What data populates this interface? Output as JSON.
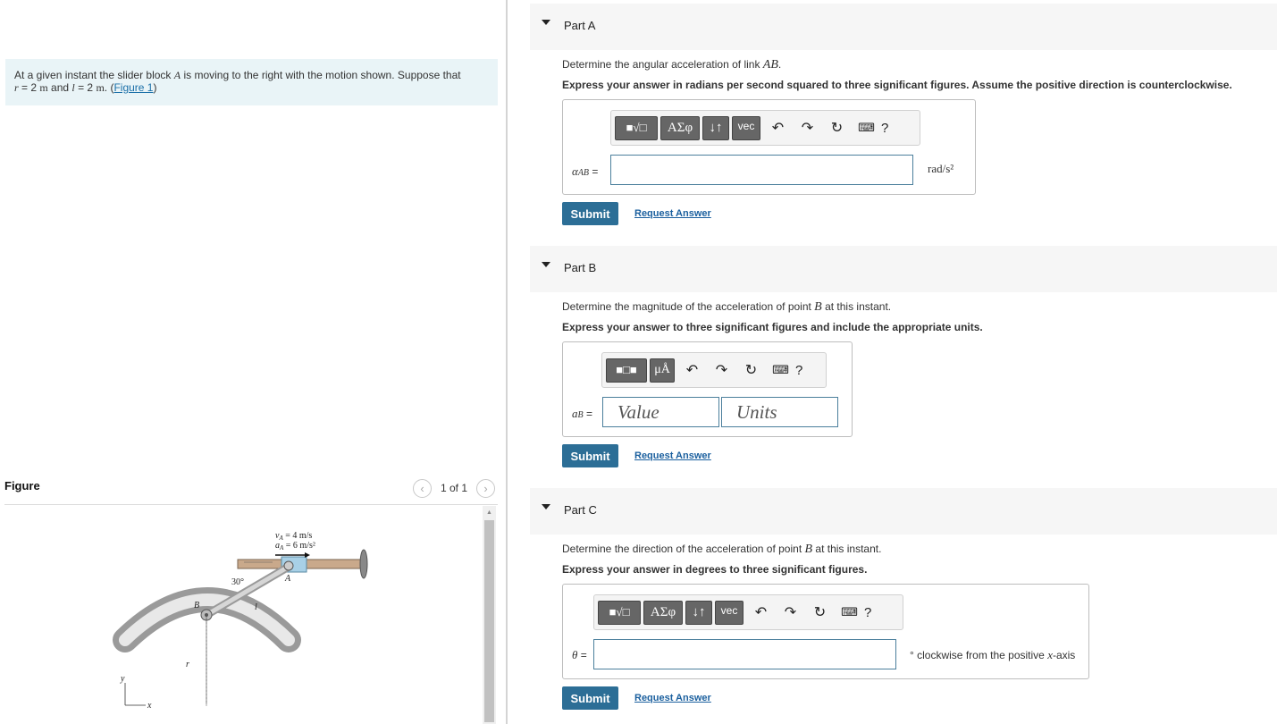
{
  "problem": {
    "text_before": "At a given instant the slider block ",
    "block_var": "A",
    "text_middle": " is moving to the right with the motion shown. Suppose that",
    "r_var": "r",
    "r_value": " = 2 ",
    "r_unit": "m",
    "and_text": " and ",
    "l_var": "l",
    "l_value": " = 2 ",
    "l_unit": "m",
    "period": ". (",
    "figure_link": "Figure 1",
    "close": ")"
  },
  "figure": {
    "title": "Figure",
    "count": "1 of 1",
    "prev_icon": "chevron-left-icon",
    "next_icon": "chevron-right-icon",
    "labels": {
      "va": "v",
      "va_sub": "A",
      "va_val": " = 4 m/s",
      "aa": "a",
      "aa_sub": "A",
      "aa_val": " = 6 m/s²",
      "angle": "30°",
      "point_a": "A",
      "point_b": "B",
      "link_l": "l",
      "radius_r": "r",
      "axis_y": "y",
      "axis_x": "x"
    }
  },
  "parts": [
    {
      "title": "Part A",
      "question_pre": "Determine the angular acceleration of link ",
      "question_var": "AB",
      "question_post": ".",
      "instruction": "Express your answer in radians per second squared to three significant figures. Assume the positive direction is counterclockwise.",
      "toolbar": [
        "templates",
        "ΑΣφ",
        "↓↑",
        "vec"
      ],
      "answer_label_var": "α",
      "answer_label_sub": "AB",
      "answer_label_eq": " =",
      "units": "rad/s²",
      "submit": "Submit",
      "request": "Request Answer"
    },
    {
      "title": "Part B",
      "question_pre": "Determine the magnitude of the acceleration of point ",
      "question_var": "B",
      "question_post": " at this instant.",
      "instruction": "Express your answer to three significant figures and include the appropriate units.",
      "toolbar": [
        "templates",
        "μÅ"
      ],
      "answer_label_var": "a",
      "answer_label_sub": "B",
      "answer_label_eq": " =",
      "value_placeholder": "Value",
      "units_placeholder": "Units",
      "submit": "Submit",
      "request": "Request Answer"
    },
    {
      "title": "Part C",
      "question_pre": "Determine the direction of the acceleration of point ",
      "question_var": "B",
      "question_post": " at this instant.",
      "instruction": "Express your answer in degrees to three significant figures.",
      "toolbar": [
        "templates",
        "ΑΣφ",
        "↓↑",
        "vec"
      ],
      "answer_label_var": "θ",
      "answer_label_eq": " =",
      "units_pre": "° clockwise from the positive ",
      "units_var": "x",
      "units_post": "-axis",
      "submit": "Submit",
      "request": "Request Answer"
    }
  ],
  "icons": {
    "undo": "undo-icon",
    "redo": "redo-icon",
    "reset": "reset-icon",
    "keyboard": "keyboard-icon",
    "help": "?"
  }
}
